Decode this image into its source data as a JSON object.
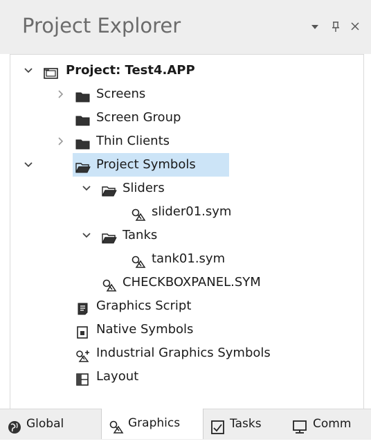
{
  "panel": {
    "title": "Project Explorer",
    "dropdown_glyph": "▾",
    "pin_glyph": "ᴨ",
    "close_glyph": "×"
  },
  "tree": {
    "project": {
      "label": "Project: Test4.APP",
      "expanded": true,
      "icon": "project-folder-icon"
    },
    "screens": {
      "label": "Screens",
      "expanded": false,
      "icon": "folder-icon"
    },
    "screen_group": {
      "label": "Screen Group",
      "icon": "folder-icon"
    },
    "thin_clients": {
      "label": "Thin Clients",
      "expanded": false,
      "icon": "folder-icon"
    },
    "project_symbols": {
      "label": "Project Symbols",
      "expanded": true,
      "selected": true,
      "icon": "folder-open-icon"
    },
    "sliders": {
      "label": "Sliders",
      "expanded": true,
      "icon": "folder-open-icon"
    },
    "slider01": {
      "label": "slider01.sym",
      "icon": "symbol-icon"
    },
    "tanks": {
      "label": "Tanks",
      "expanded": true,
      "icon": "folder-open-icon"
    },
    "tank01": {
      "label": "tank01.sym",
      "icon": "symbol-icon"
    },
    "checkboxpanel": {
      "label": "CHECKBOXPANEL.SYM",
      "icon": "symbol-icon"
    },
    "graphics_script": {
      "label": "Graphics Script",
      "icon": "script-icon"
    },
    "native_symbols": {
      "label": "Native Symbols",
      "icon": "native-symbol-icon"
    },
    "industrial_symbols": {
      "label": "Industrial Graphics Symbols",
      "icon": "industrial-symbol-icon"
    },
    "layout": {
      "label": "Layout",
      "icon": "layout-icon"
    }
  },
  "tabs": [
    {
      "label": "Global",
      "icon": "globe-icon",
      "active": false
    },
    {
      "label": "Graphics",
      "icon": "symbol-icon",
      "active": true
    },
    {
      "label": "Tasks",
      "icon": "tasks-icon",
      "active": false
    },
    {
      "label": "Comm",
      "icon": "monitor-icon",
      "active": false
    }
  ],
  "colors": {
    "selection": "#cce4f7",
    "title_text": "#6b6b6b",
    "chrome_bg": "#eeeeee"
  }
}
